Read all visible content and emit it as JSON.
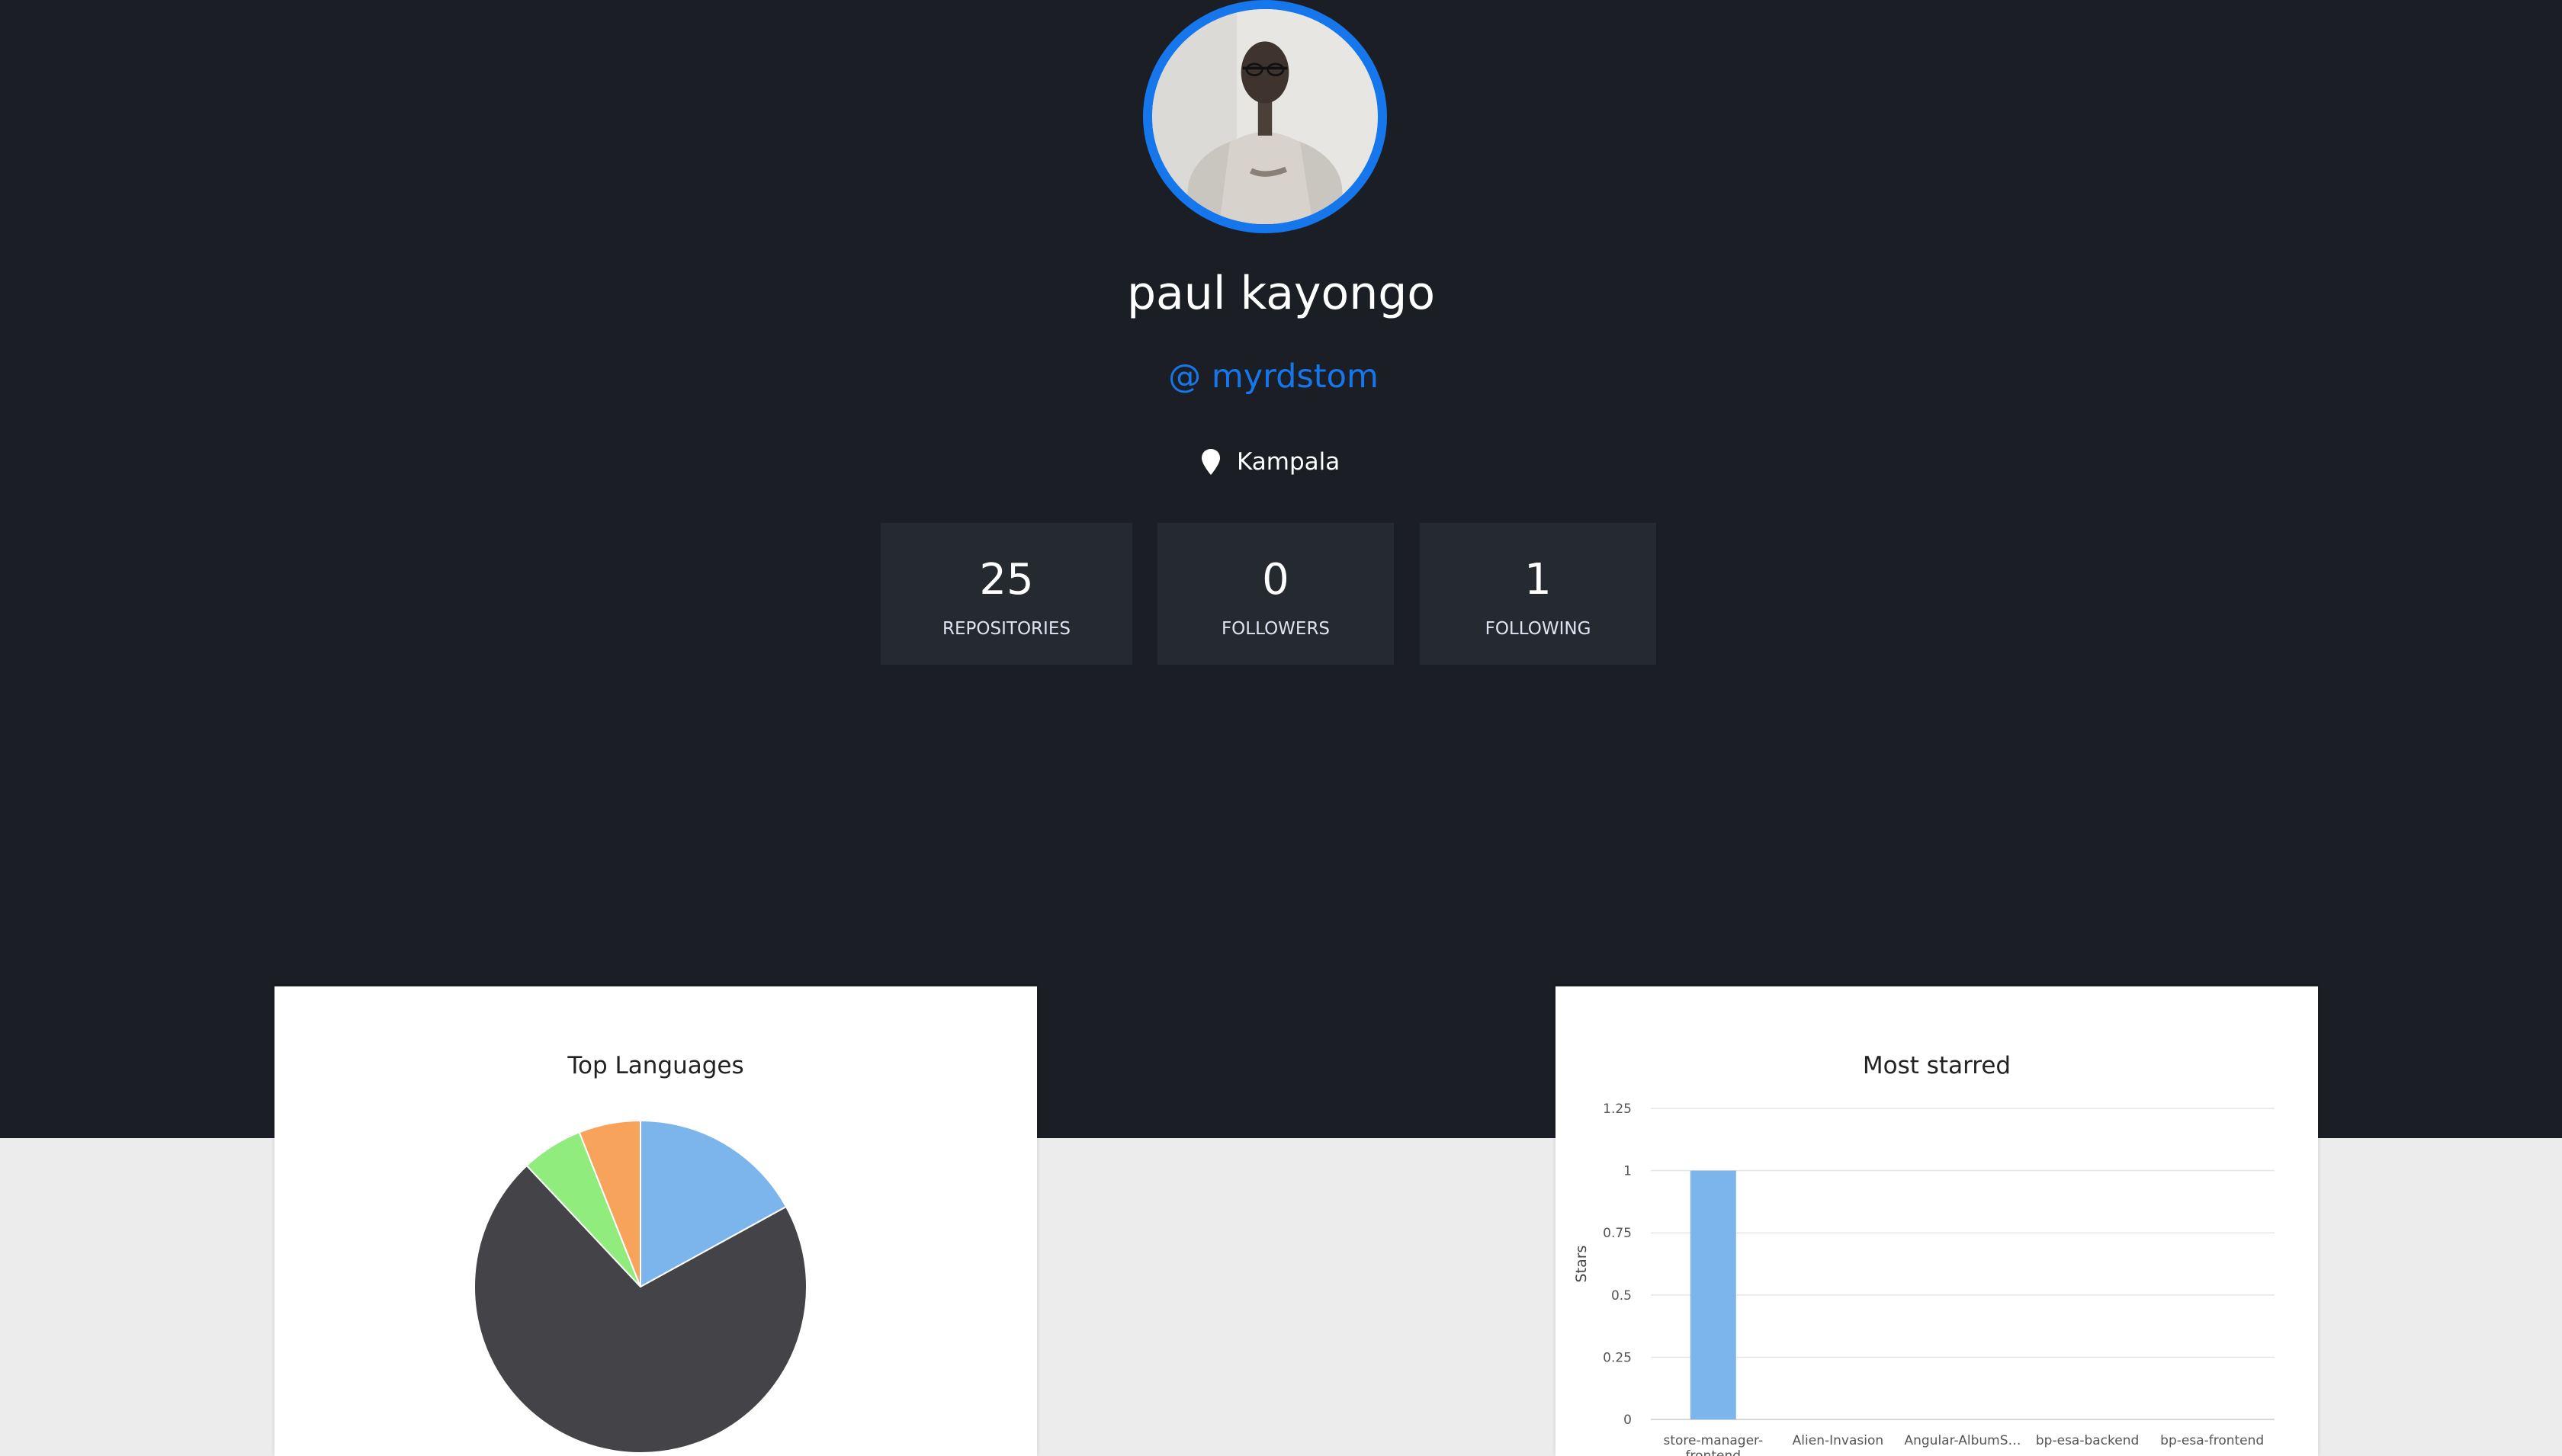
{
  "profile": {
    "name": "paul kayongo",
    "handle": "@ myrdstom",
    "location": "Kampala",
    "location_icon": "map-pin-icon"
  },
  "stats": [
    {
      "value": "25",
      "label": "REPOSITORIES"
    },
    {
      "value": "0",
      "label": "FOLLOWERS"
    },
    {
      "value": "1",
      "label": "FOLLOWING"
    }
  ],
  "charts": {
    "languages_title": "Top Languages",
    "starred_title": "Most starred",
    "starred_ylabel": "Stars"
  },
  "colors": {
    "accent": "#1676ec",
    "hero_bg": "#1b1f25",
    "stat_bg": "#252a30",
    "page_bg": "#ececec"
  },
  "chart_data": [
    {
      "type": "pie",
      "title": "Top Languages",
      "slices": [
        {
          "value": 17,
          "color": "#7cb5ec"
        },
        {
          "value": 71,
          "color": "#434348"
        },
        {
          "value": 6,
          "color": "#90ed7d"
        },
        {
          "value": 6,
          "color": "#f7a35c"
        }
      ]
    },
    {
      "type": "bar",
      "title": "Most starred",
      "ylabel": "Stars",
      "xlabel": "",
      "categories": [
        "store-manager-frontend",
        "Alien-Invasion",
        "Angular-AlbumS…",
        "bp-esa-backend",
        "bp-esa-frontend"
      ],
      "category_lines": [
        [
          "store-manager-",
          "frontend"
        ],
        [
          "Alien-Invasion"
        ],
        [
          "Angular-AlbumS…"
        ],
        [
          "bp-esa-backend"
        ],
        [
          "bp-esa-frontend"
        ]
      ],
      "values": [
        1,
        0,
        0,
        0,
        0
      ],
      "ylim": [
        0,
        1.25
      ],
      "yticks": [
        "0",
        "0.25",
        "0.5",
        "0.75",
        "1",
        "1.25"
      ],
      "grid": true,
      "bar_color": "#7cb5ec"
    }
  ]
}
